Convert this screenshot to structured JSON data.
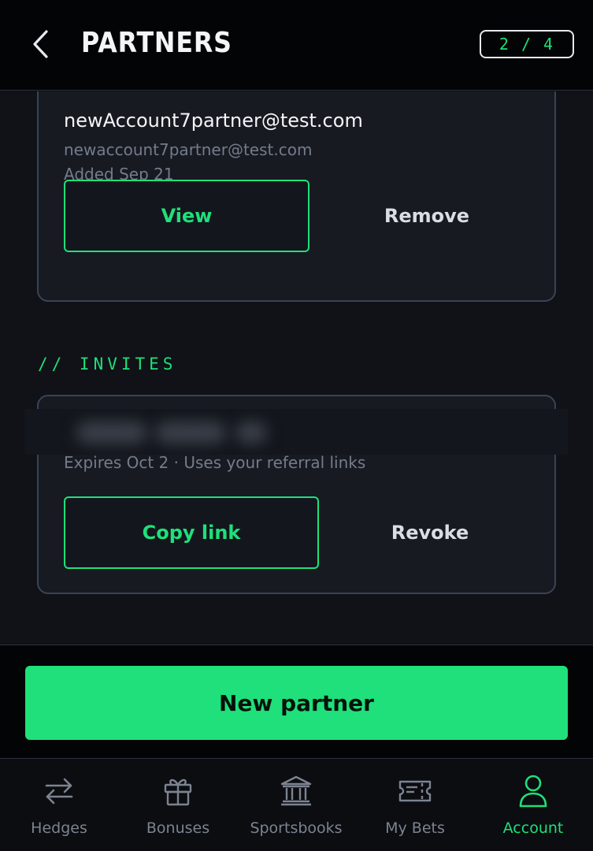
{
  "header": {
    "title": "PARTNERS",
    "step": "2 / 4",
    "back_icon": "chevron-left-icon"
  },
  "partner": {
    "name": "newAccount7partner@test.com",
    "email": "newaccount7partner@test.com",
    "added": "Added Sep 21",
    "view_label": "View",
    "remove_label": "Remove"
  },
  "invites": {
    "section_label": "// INVITES",
    "items": [
      {
        "meta": "Expires Oct 2 · Uses your referral links",
        "copy_label": "Copy link",
        "revoke_label": "Revoke"
      }
    ]
  },
  "actions": {
    "new_partner_label": "New partner"
  },
  "nav": {
    "items": [
      {
        "label": "Hedges",
        "icon": "swap-arrows-icon",
        "active": false
      },
      {
        "label": "Bonuses",
        "icon": "gift-icon",
        "active": false
      },
      {
        "label": "Sportsbooks",
        "icon": "bank-icon",
        "active": false
      },
      {
        "label": "My Bets",
        "icon": "ticket-icon",
        "active": false
      },
      {
        "label": "Account",
        "icon": "user-icon",
        "active": true
      }
    ]
  },
  "colors": {
    "accent": "#1fe07a",
    "background": "#101217",
    "card": "#171a21",
    "card_border": "#3a4354",
    "muted_text": "#747c8a"
  }
}
